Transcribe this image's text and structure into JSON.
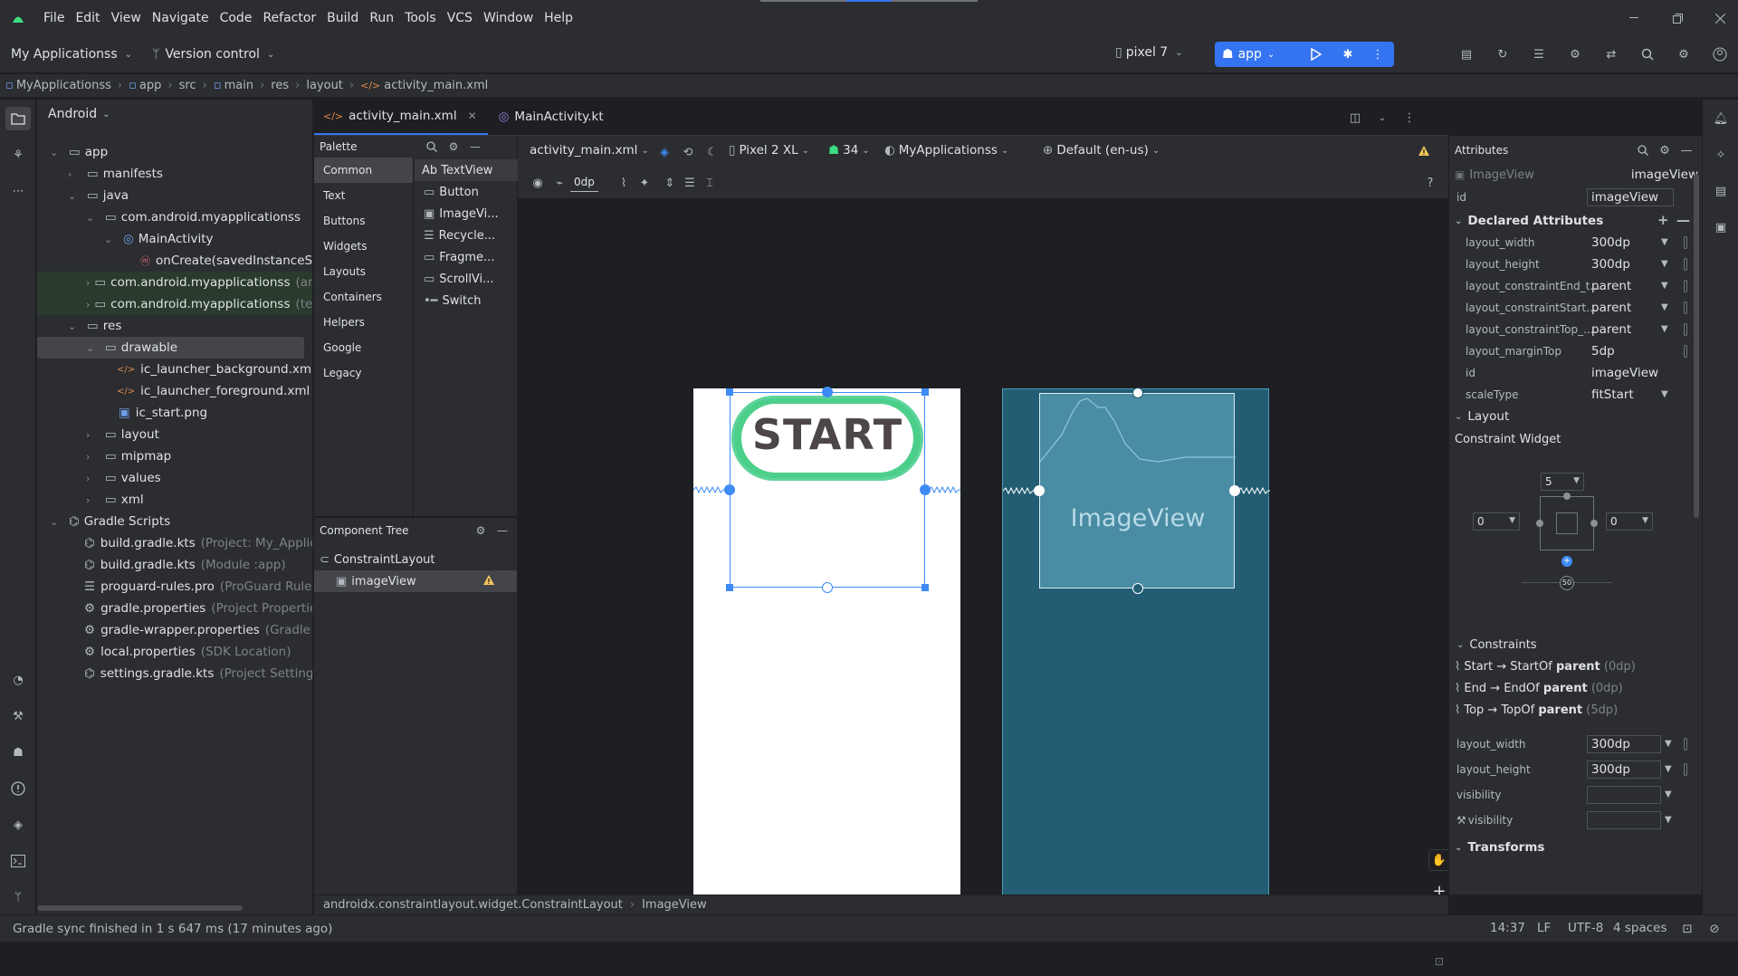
{
  "menu": [
    "File",
    "Edit",
    "View",
    "Navigate",
    "Code",
    "Refactor",
    "Build",
    "Run",
    "Tools",
    "VCS",
    "Window",
    "Help"
  ],
  "toolbar": {
    "project_name": "My Applicationss",
    "version_control": "Version control",
    "device": "pixel 7",
    "run_config": "app"
  },
  "breadcrumb": [
    "MyApplicationss",
    "app",
    "src",
    "main",
    "res",
    "layout",
    "activity_main.xml"
  ],
  "project_panel": {
    "view_mode": "Android",
    "tree": [
      {
        "label": "app",
        "sub": ""
      },
      {
        "label": "manifests",
        "sub": ""
      },
      {
        "label": "java",
        "sub": ""
      },
      {
        "label": "com.android.myapplicationss",
        "sub": ""
      },
      {
        "label": "MainActivity",
        "sub": ""
      },
      {
        "label": "onCreate(savedInstanceS",
        "sub": ""
      },
      {
        "label": "com.android.myapplicationss",
        "sub": "(andr"
      },
      {
        "label": "com.android.myapplicationss",
        "sub": "(test"
      },
      {
        "label": "res",
        "sub": ""
      },
      {
        "label": "drawable",
        "sub": ""
      },
      {
        "label": "ic_launcher_background.xml",
        "sub": ""
      },
      {
        "label": "ic_launcher_foreground.xml",
        "sub": ""
      },
      {
        "label": "ic_start.png",
        "sub": ""
      },
      {
        "label": "layout",
        "sub": ""
      },
      {
        "label": "mipmap",
        "sub": ""
      },
      {
        "label": "values",
        "sub": ""
      },
      {
        "label": "xml",
        "sub": ""
      },
      {
        "label": "Gradle Scripts",
        "sub": ""
      },
      {
        "label": "build.gradle.kts",
        "sub": "(Project: My_Applicati"
      },
      {
        "label": "build.gradle.kts",
        "sub": "(Module :app)"
      },
      {
        "label": "proguard-rules.pro",
        "sub": "(ProGuard Rules f"
      },
      {
        "label": "gradle.properties",
        "sub": "(Project Properties)"
      },
      {
        "label": "gradle-wrapper.properties",
        "sub": "(Gradle Ve"
      },
      {
        "label": "local.properties",
        "sub": "(SDK Location)"
      },
      {
        "label": "settings.gradle.kts",
        "sub": "(Project Settings)"
      }
    ]
  },
  "tabs": [
    {
      "label": "activity_main.xml"
    },
    {
      "label": "MainActivity.kt"
    }
  ],
  "palette": {
    "title": "Palette",
    "categories": [
      "Common",
      "Text",
      "Buttons",
      "Widgets",
      "Layouts",
      "Containers",
      "Helpers",
      "Google",
      "Legacy"
    ],
    "items": [
      "Ab TextView",
      "Button",
      "ImageVi...",
      "Recycle...",
      "Fragme...",
      "ScrollVi...",
      "Switch"
    ]
  },
  "component_tree": {
    "title": "Component Tree",
    "root": "ConstraintLayout",
    "child": "imageView"
  },
  "design_toolbar": {
    "file": "activity_main.xml",
    "device": "Pixel 2 XL",
    "api": "34",
    "theme": "MyApplicationss",
    "locale": "Default (en-us)",
    "margin": "0dp"
  },
  "canvas": {
    "start_text": "START",
    "blueprint_label": "ImageView"
  },
  "attributes": {
    "title": "Attributes",
    "widget_type": "ImageView",
    "widget_id": "imageView",
    "id_label": "id",
    "id_value": "imageView",
    "declared_title": "Declared Attributes",
    "declared": [
      {
        "name": "layout_width",
        "value": "300dp"
      },
      {
        "name": "layout_height",
        "value": "300dp"
      },
      {
        "name": "layout_constraintEnd_t...",
        "value": "parent"
      },
      {
        "name": "layout_constraintStart...",
        "value": "parent"
      },
      {
        "name": "layout_constraintTop_...",
        "value": "parent"
      },
      {
        "name": "layout_marginTop",
        "value": "5dp"
      },
      {
        "name": "id",
        "value": "imageView"
      },
      {
        "name": "scaleType",
        "value": "fitStart"
      }
    ],
    "layout_title": "Layout",
    "constraint_widget": "Constraint Widget",
    "margin_top": "5",
    "margin_left": "0",
    "margin_right": "0",
    "bias": "50",
    "constraints_title": "Constraints",
    "constraints": [
      {
        "a": "Start → StartOf",
        "b": "parent",
        "c": "(0dp)"
      },
      {
        "a": "End → EndOf",
        "b": "parent",
        "c": "(0dp)"
      },
      {
        "a": "Top → TopOf",
        "b": "parent",
        "c": "(5dp)"
      }
    ],
    "layout_fields": [
      {
        "name": "layout_width",
        "value": "300dp"
      },
      {
        "name": "layout_height",
        "value": "300dp"
      },
      {
        "name": "visibility",
        "value": ""
      },
      {
        "name": "visibility",
        "value": ""
      }
    ],
    "transforms_title": "Transforms"
  },
  "editor_footer": [
    "androidx.constraintlayout.widget.ConstraintLayout",
    "ImageView"
  ],
  "status": {
    "message": "Gradle sync finished in 1 s 647 ms (17 minutes ago)",
    "position": "14:37",
    "line_sep": "LF",
    "encoding": "UTF-8",
    "indent": "4 spaces"
  },
  "colors": {
    "accent": "#3574f0",
    "blueprint": "#235d73",
    "start_green": "#4ccf8a"
  }
}
